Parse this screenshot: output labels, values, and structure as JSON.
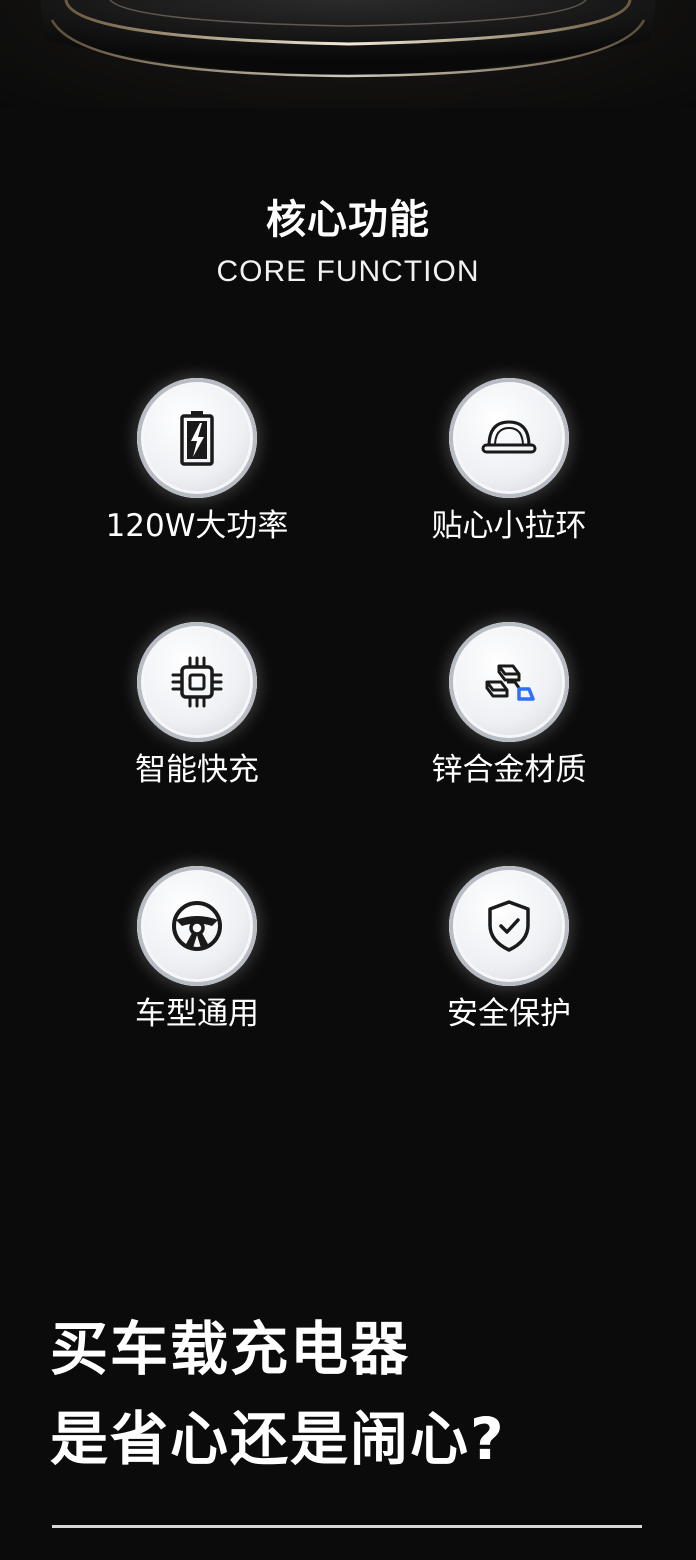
{
  "section": {
    "title": "核心功能",
    "subtitle": "CORE FUNCTION"
  },
  "features": [
    {
      "label": "120W大功率",
      "icon": "battery-charging-icon"
    },
    {
      "label": "贴心小拉环",
      "icon": "pull-ring-icon"
    },
    {
      "label": "智能快充",
      "icon": "chip-icon"
    },
    {
      "label": "锌合金材质",
      "icon": "metal-ingots-icon"
    },
    {
      "label": "车型通用",
      "icon": "steering-wheel-icon"
    },
    {
      "label": "安全保护",
      "icon": "shield-check-icon"
    }
  ],
  "headline": {
    "line1": "买车载充电器",
    "line2": "是省心还是闹心?"
  },
  "colors": {
    "background": "#0b0b0b",
    "text": "#ffffff",
    "icon": "#1a1a1a",
    "accent": "#2f6fff"
  }
}
